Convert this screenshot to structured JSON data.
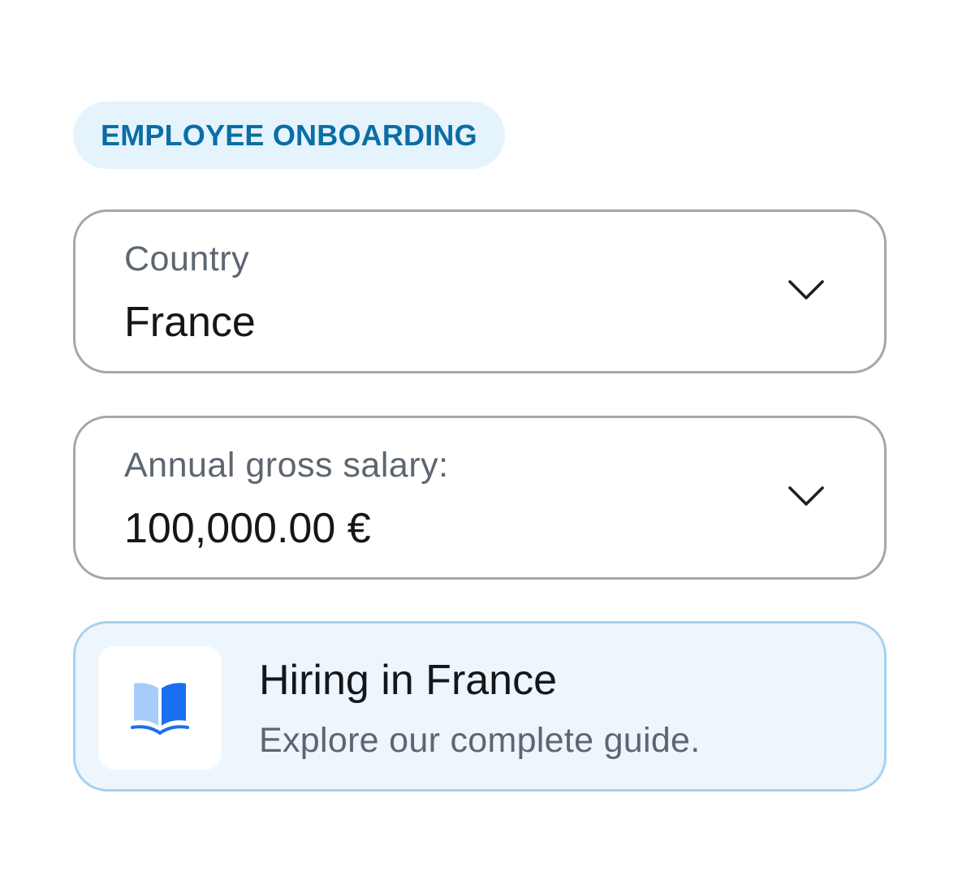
{
  "badge": {
    "label": "EMPLOYEE ONBOARDING"
  },
  "country_field": {
    "label": "Country",
    "value": "France",
    "icon": "chevron-down-icon"
  },
  "salary_field": {
    "label": "Annual gross salary:",
    "value": "100,000.00 €",
    "icon": "chevron-down-icon"
  },
  "guide_card": {
    "title": "Hiring in France",
    "subtitle": "Explore our complete guide.",
    "icon": "book-icon"
  },
  "colors": {
    "badge_bg": "#e5f3fc",
    "badge_text": "#0a6ea5",
    "field_border": "#a3a8ae",
    "guide_bg": "#edf5fd",
    "guide_border": "#a6d2f0",
    "book_light": "#a9cbfb",
    "book_dark": "#1a6ff0"
  }
}
